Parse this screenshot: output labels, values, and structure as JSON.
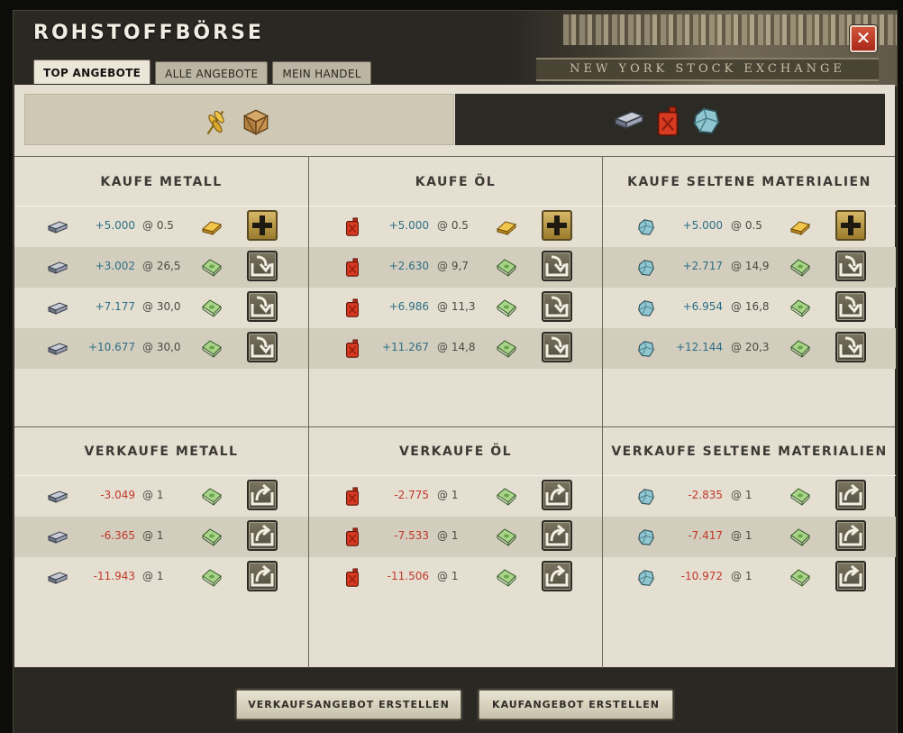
{
  "window": {
    "title": "ROHSTOFFBÖRSE",
    "header_banner": "NEW YORK STOCK EXCHANGE",
    "close_label": "✕"
  },
  "tabs": [
    {
      "label": "TOP ANGEBOTE",
      "active": true
    },
    {
      "label": "ALLE ANGEBOTE",
      "active": false
    },
    {
      "label": "MEIN HANDEL",
      "active": false
    }
  ],
  "filters": {
    "left": {
      "icons": [
        "wheat-icon",
        "crate-icon"
      ],
      "selected": false
    },
    "right": {
      "icons": [
        "metal-ingot-icon",
        "oil-canister-icon",
        "rare-material-icon"
      ],
      "selected": true
    }
  },
  "buy": [
    {
      "title": "KAUFE METALL",
      "resource_icon": "metal-ingot-icon",
      "rows": [
        {
          "amount": "+5.000",
          "price": "@ 0.5",
          "currency": "gold-icon",
          "action": "plus"
        },
        {
          "amount": "+3.002",
          "price": "@ 26,5",
          "currency": "cash-icon",
          "action": "deal"
        },
        {
          "amount": "+7.177",
          "price": "@ 30,0",
          "currency": "cash-icon",
          "action": "deal"
        },
        {
          "amount": "+10.677",
          "price": "@ 30,0",
          "currency": "cash-icon",
          "action": "deal"
        }
      ]
    },
    {
      "title": "KAUFE ÖL",
      "resource_icon": "oil-canister-icon",
      "rows": [
        {
          "amount": "+5.000",
          "price": "@ 0.5",
          "currency": "gold-icon",
          "action": "plus"
        },
        {
          "amount": "+2.630",
          "price": "@ 9,7",
          "currency": "cash-icon",
          "action": "deal"
        },
        {
          "amount": "+6.986",
          "price": "@ 11,3",
          "currency": "cash-icon",
          "action": "deal"
        },
        {
          "amount": "+11.267",
          "price": "@ 14,8",
          "currency": "cash-icon",
          "action": "deal"
        }
      ]
    },
    {
      "title": "KAUFE SELTENE MATERIALIEN",
      "resource_icon": "rare-material-icon",
      "rows": [
        {
          "amount": "+5.000",
          "price": "@ 0.5",
          "currency": "gold-icon",
          "action": "plus"
        },
        {
          "amount": "+2.717",
          "price": "@ 14,9",
          "currency": "cash-icon",
          "action": "deal"
        },
        {
          "amount": "+6.954",
          "price": "@ 16,8",
          "currency": "cash-icon",
          "action": "deal"
        },
        {
          "amount": "+12.144",
          "price": "@ 20,3",
          "currency": "cash-icon",
          "action": "deal"
        }
      ]
    }
  ],
  "sell": [
    {
      "title": "VERKAUFE METALL",
      "resource_icon": "metal-ingot-icon",
      "rows": [
        {
          "amount": "-3.049",
          "price": "@ 1",
          "currency": "cash-icon",
          "action": "sell"
        },
        {
          "amount": "-6.365",
          "price": "@ 1",
          "currency": "cash-icon",
          "action": "sell"
        },
        {
          "amount": "-11.943",
          "price": "@ 1",
          "currency": "cash-icon",
          "action": "sell"
        }
      ]
    },
    {
      "title": "VERKAUFE ÖL",
      "resource_icon": "oil-canister-icon",
      "rows": [
        {
          "amount": "-2.775",
          "price": "@ 1",
          "currency": "cash-icon",
          "action": "sell"
        },
        {
          "amount": "-7.533",
          "price": "@ 1",
          "currency": "cash-icon",
          "action": "sell"
        },
        {
          "amount": "-11.506",
          "price": "@ 1",
          "currency": "cash-icon",
          "action": "sell"
        }
      ]
    },
    {
      "title": "VERKAUFE SELTENE MATERIALIEN",
      "resource_icon": "rare-material-icon",
      "rows": [
        {
          "amount": "-2.835",
          "price": "@ 1",
          "currency": "cash-icon",
          "action": "sell"
        },
        {
          "amount": "-7.417",
          "price": "@ 1",
          "currency": "cash-icon",
          "action": "sell"
        },
        {
          "amount": "-10.972",
          "price": "@ 1",
          "currency": "cash-icon",
          "action": "sell"
        }
      ]
    }
  ],
  "footer": {
    "create_sell_offer": "VERKAUFSANGEBOT ERSTELLEN",
    "create_buy_offer": "KAUFANGEBOT ERSTELLEN"
  },
  "colors": {
    "positive": "#2f6f86",
    "negative": "#c1392b",
    "panel": "#e4dfd1",
    "dark": "#2a2823"
  }
}
